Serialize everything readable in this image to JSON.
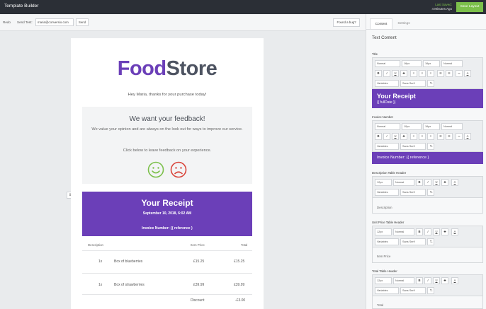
{
  "topbar": {
    "title": "Template Builder",
    "saved_line1": "Last Saved:",
    "saved_line2": "4 Minutes Ago",
    "save_button": "Save Layout"
  },
  "toolbar": {
    "redo": "Redo",
    "send_test_label": "Send Test:",
    "email_value": "maria@conversio.com",
    "send_button": "Send",
    "bug_button": "Found a bug?",
    "drag_handle_icon": "drag-handle-icon"
  },
  "email": {
    "logo_food": "Food",
    "logo_store": "Store",
    "thanks": "Hey Maria, thanks for your purchase today!",
    "feedback_title": "We want your feedback!",
    "feedback_text": "We value your opinion and are always on the look out for ways to improve our service.",
    "feedback_click": "Click below to leave feedback on your experience.",
    "happy_icon": "happy-face-icon",
    "sad_icon": "sad-face-icon",
    "happy_color": "#7cc04b",
    "sad_color": "#d9443a",
    "receipt_title": "Your Receipt",
    "receipt_date": "September 10, 2018, 6:02 AM",
    "receipt_invoice": "Invoice Number: {{ reference }",
    "brand_color": "#6b3fb8",
    "table": {
      "headers": [
        "Description",
        "Item Price",
        "Total"
      ],
      "rows": [
        {
          "qty": "1x",
          "desc": "Box of blueberries",
          "price": "£15.25",
          "total": "£15.25"
        },
        {
          "qty": "1x",
          "desc": "Box of strawberries",
          "price": "£39.99",
          "total": "£39.99"
        }
      ],
      "discount_label": "Discount",
      "discount_value": "-£3.00"
    }
  },
  "panel": {
    "tabs": [
      "Content",
      "Settings"
    ],
    "heading": "Text Content",
    "title_section": {
      "label": "Title",
      "style_select": "Normal",
      "size_select": "16px",
      "line_height": "16px",
      "letter_select": "Normal",
      "variables": "Variables",
      "font_select": "Sans Serif",
      "preview_title": "Your Receipt",
      "preview_sub": "{{ fullDate }}"
    },
    "invoice_section": {
      "label": "Invoice Number",
      "style_select": "Normal",
      "size_select": "10px",
      "line_height": "16px",
      "letter_select": "Normal",
      "variables": "Variables",
      "font_select": "Sans Serif",
      "preview": "Invoice Number: {{ reference }"
    },
    "desc_section": {
      "label": "Description Table Header",
      "size_select": "12px",
      "letter_select": "Normal",
      "variables": "Variables",
      "font_select": "Sans Serif",
      "preview": "Description"
    },
    "unit_section": {
      "label": "Unit Price Table Header",
      "size_select": "12px",
      "letter_select": "Normal",
      "variables": "Variables",
      "font_select": "Sans Serif",
      "preview": "Item Price"
    },
    "total_section": {
      "label": "Total Table Header",
      "size_select": "12px",
      "letter_select": "Normal",
      "variables": "Variables",
      "font_select": "Sans Serif",
      "preview": "Total"
    },
    "format_icons": [
      "bold-icon",
      "italic-icon",
      "underline-icon",
      "strikethrough-icon",
      "align-left-icon",
      "align-center-icon",
      "align-right-icon",
      "bullet-list-icon",
      "numbered-list-icon",
      "link-icon",
      "text-color-icon",
      "clear-format-icon"
    ],
    "format_glyphs": {
      "bold": "B",
      "italic": "I",
      "underline": "U",
      "strike": "S",
      "color": "A",
      "clear": "T̶",
      "link": "🔗"
    }
  }
}
